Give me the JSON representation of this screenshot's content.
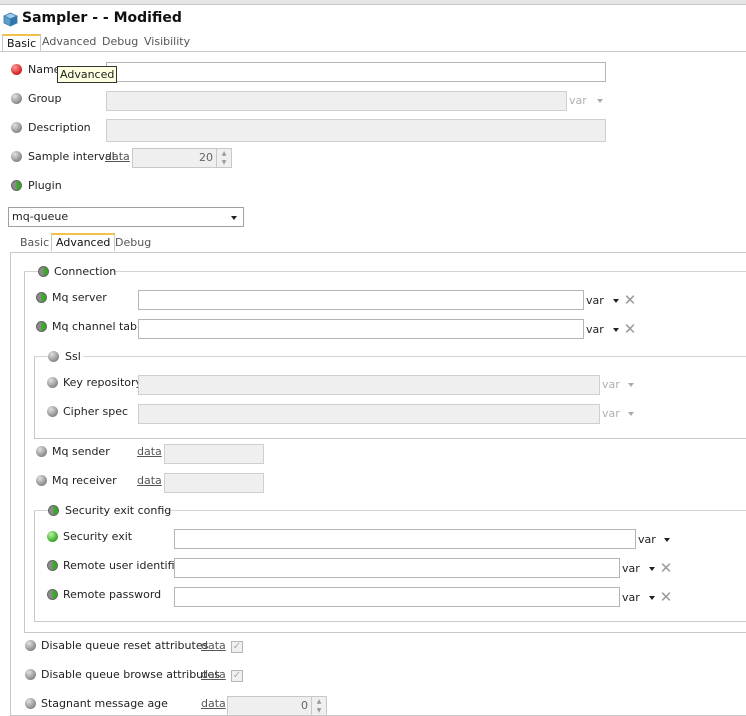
{
  "window": {
    "title": "Sampler -  - Modified"
  },
  "top_tabs": [
    "Basic",
    "Advanced",
    "Debug",
    "Visibility"
  ],
  "tooltip": "Advanced",
  "fields": {
    "name": "Name",
    "group": "Group",
    "description": "Description",
    "sample_interval": "Sample interval",
    "sample_interval_value": "20",
    "plugin": "Plugin"
  },
  "data_link": "data",
  "var_label": "var",
  "plugin_select": "mq-queue",
  "inner_tabs": [
    "Basic",
    "Advanced",
    "Debug"
  ],
  "connection": {
    "title": "Connection",
    "mq_server": "Mq server",
    "mq_channel_table": "Mq channel table",
    "ssl": {
      "title": "Ssl",
      "key_repository": "Key repository",
      "cipher_spec": "Cipher spec"
    },
    "mq_sender": "Mq sender",
    "mq_receiver": "Mq receiver",
    "security_exit_config": {
      "title": "Security exit config",
      "security_exit": "Security exit",
      "remote_user_identifier": "Remote user identifier",
      "remote_password": "Remote password"
    }
  },
  "bottom": {
    "disable_queue_reset": "Disable queue reset attributes",
    "disable_queue_browse": "Disable queue browse attributes",
    "stagnant_message_age": "Stagnant message age",
    "stagnant_value": "0"
  },
  "icons": {
    "app": "cube-icon",
    "state_red": "red-status-icon",
    "state_gray": "gray-status-icon",
    "state_green": "green-status-icon",
    "clear": "clear-x-icon"
  },
  "colors": {
    "tab_accent": "#f2c04b",
    "red": "#d42020",
    "green": "#3aa828"
  }
}
